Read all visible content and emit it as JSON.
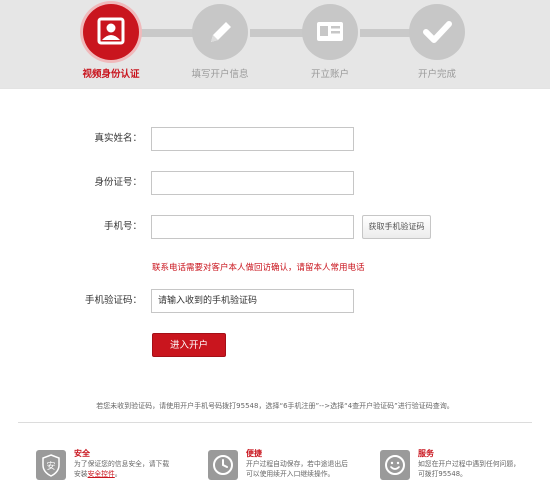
{
  "steps": [
    {
      "label": "视频身份认证",
      "icon": "portrait-icon"
    },
    {
      "label": "填写开户信息",
      "icon": "pencil-icon"
    },
    {
      "label": "开立账户",
      "icon": "id-card-icon"
    },
    {
      "label": "开户完成",
      "icon": "checkmark-icon"
    }
  ],
  "form": {
    "name_label": "真实姓名：",
    "id_label": "身份证号：",
    "phone_label": "手机号：",
    "get_code_label": "获取手机验证码",
    "warning": "联系电话需要对客户本人做回访确认，请留本人常用电话",
    "code_label": "手机验证码：",
    "code_placeholder": "请输入收到的手机验证码",
    "submit_label": "进入开户"
  },
  "help_text": "若您未收到验证码，请使用开户手机号码拨打95548，选择“6手机注册”-->选择“4查开户验证码”进行验证码查询。",
  "features": [
    {
      "title": "安全",
      "line1": "为了保证您的信息安全，请下载",
      "line2_prefix": "安装",
      "line2_link": "安全控件",
      "line2_suffix": "。",
      "icon": "shield-icon"
    },
    {
      "title": "便捷",
      "line1": "开户过程自动保存，若中途退出后",
      "line2_prefix": "可以使用续开入口继续操作。",
      "icon": "clock-icon"
    },
    {
      "title": "服务",
      "line1": "如您在开户过程中遇到任何问题，",
      "line2_prefix": "可拨打95548。",
      "icon": "smiley-icon"
    }
  ],
  "colors": {
    "accent": "#c9151e",
    "inactive": "#c7c7c7"
  }
}
